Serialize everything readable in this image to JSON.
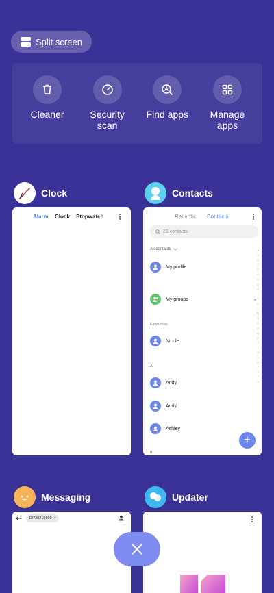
{
  "split_screen": {
    "label": "Split screen"
  },
  "quick_actions": [
    {
      "label": "Cleaner",
      "icon": "trash-icon"
    },
    {
      "label": "Security\nscan",
      "icon": "speedometer-icon"
    },
    {
      "label": "Find apps",
      "icon": "search-app-icon"
    },
    {
      "label": "Manage\napps",
      "icon": "grid-icon"
    }
  ],
  "apps": {
    "clock": {
      "name": "Clock",
      "tabs": [
        "Alarm",
        "Clock",
        "Stopwatch"
      ],
      "active_tab": "Alarm"
    },
    "contacts": {
      "name": "Contacts",
      "tabs": [
        "Recents",
        "Contacts"
      ],
      "active_tab": "Contacts",
      "search_placeholder": "23 contacts",
      "filter": "All contacts",
      "rows": {
        "my_profile": "My profile",
        "my_groups": "My groups",
        "favourites_header": "Favourites",
        "nicole": "Nicole",
        "section_a": "A",
        "andy_1": "Andy",
        "andy_2": "Andy",
        "ashley": "Ashley",
        "section_b": "B"
      },
      "alphabet": [
        "♥",
        "A",
        "B",
        "C",
        "D",
        "E",
        "F",
        "G",
        "H",
        "I",
        "J",
        "K",
        "L",
        "M",
        "N",
        "O",
        "P",
        "Q",
        "R",
        "S",
        "T",
        "U",
        "V",
        "W",
        "X",
        "Y",
        "Z",
        "#"
      ],
      "add_label": "+"
    },
    "messaging": {
      "name": "Messaging",
      "recipient": "18730218809"
    },
    "updater": {
      "name": "Updater"
    }
  },
  "colors": {
    "background": "#3a3296",
    "accent_blue": "#3d86f0",
    "contact_avatar": "#6d86e8",
    "group_avatar": "#63c46e",
    "close_button": "#7e8bef"
  }
}
